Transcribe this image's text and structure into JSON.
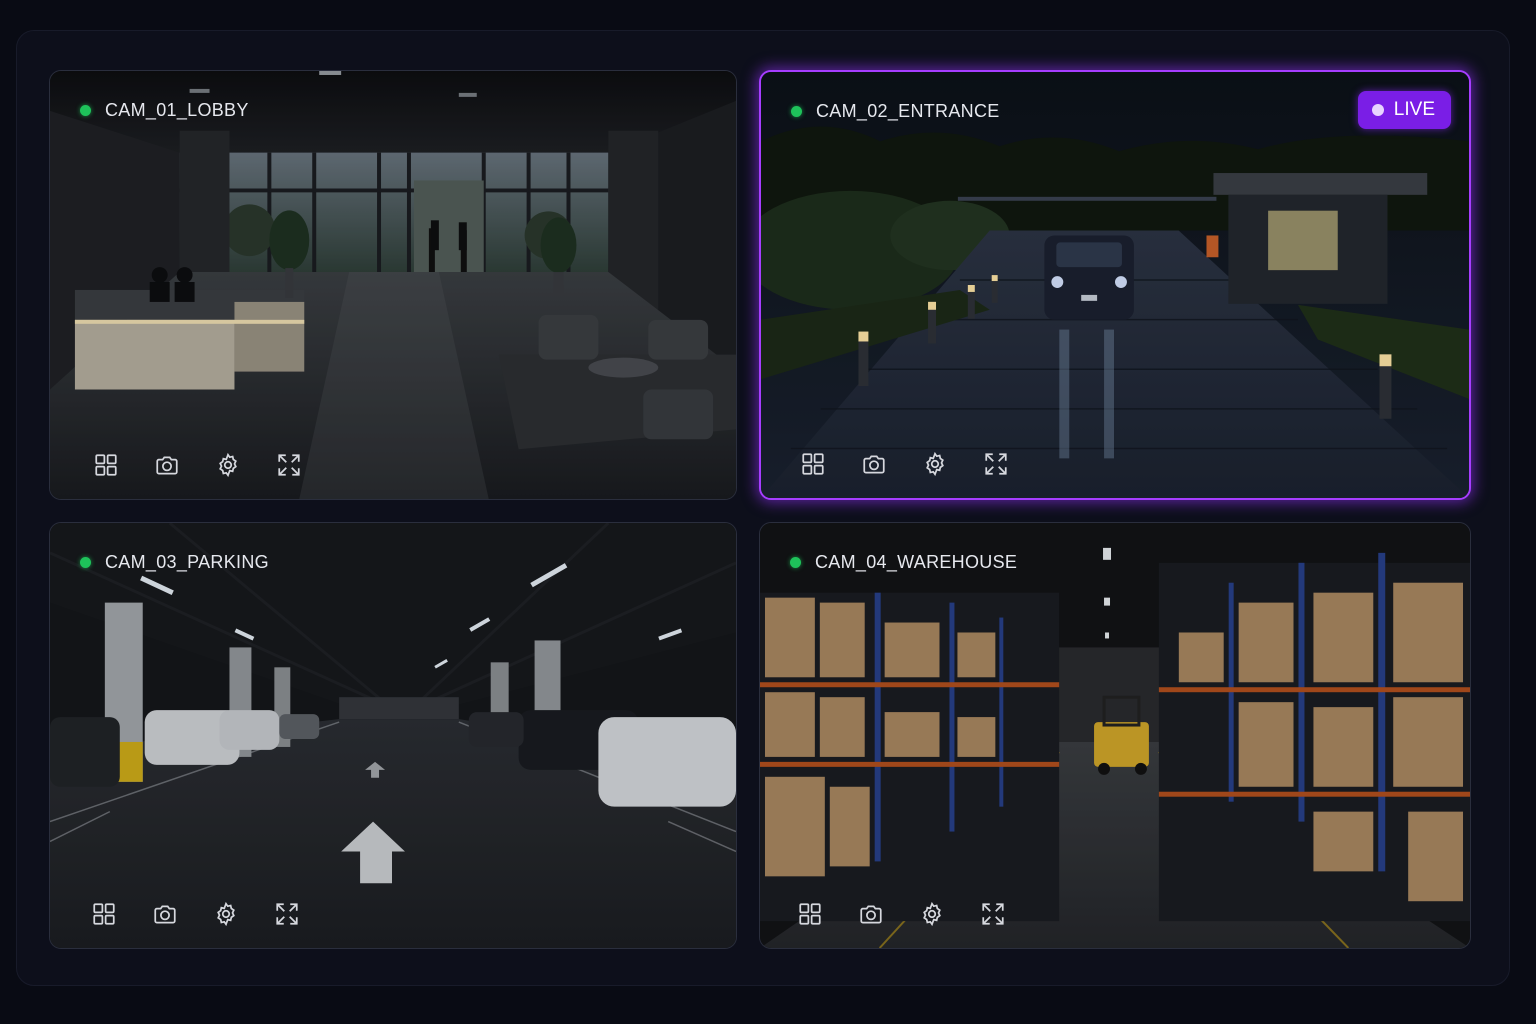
{
  "cameras": [
    {
      "name": "CAM_01_LOBBY",
      "status": "online",
      "status_color": "#1ec25a",
      "scene": "lobby",
      "active": false,
      "toolbar": [
        "grid-icon",
        "camera-icon",
        "gear-icon",
        "fullscreen-icon"
      ]
    },
    {
      "name": "CAM_02_ENTRANCE",
      "status": "online",
      "status_color": "#1ec25a",
      "scene": "entrance",
      "active": true,
      "badge": "LIVE",
      "toolbar": [
        "grid-icon",
        "camera-icon",
        "gear-icon",
        "fullscreen-icon"
      ]
    },
    {
      "name": "CAM_03_PARKING",
      "status": "online",
      "status_color": "#1ec25a",
      "scene": "parking",
      "active": false,
      "toolbar": [
        "grid-icon",
        "camera-icon",
        "gear-icon",
        "fullscreen-icon"
      ]
    },
    {
      "name": "CAM_04_WAREHOUSE",
      "status": "online",
      "status_color": "#1ec25a",
      "scene": "warehouse",
      "active": false,
      "toolbar": [
        "grid-icon",
        "camera-icon",
        "gear-icon",
        "fullscreen-icon"
      ]
    }
  ],
  "accent": "#a63dff",
  "live_badge_color": "#7a1ee6"
}
